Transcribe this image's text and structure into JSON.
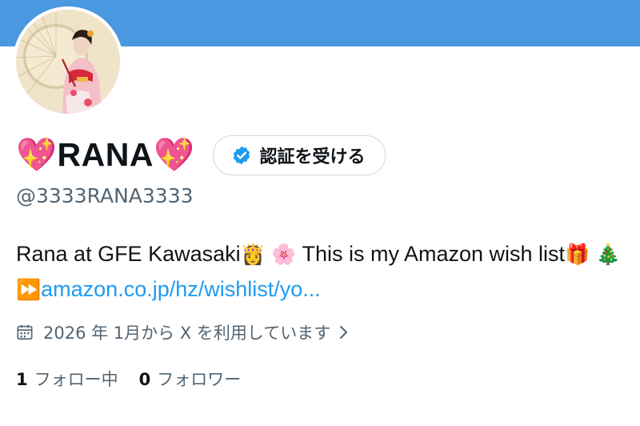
{
  "colors": {
    "banner": "#4a98e0",
    "link": "#1d9bf0",
    "secondary_text": "#536471",
    "verified_badge": "#1d9bf0"
  },
  "profile": {
    "avatar_icon": "avatar-photo",
    "display_name": "💖RANA💖",
    "handle": "@3333RANA3333",
    "verify_button": {
      "icon": "verified-badge-icon",
      "label": "認証を受ける"
    }
  },
  "bio": {
    "text_part1": "Rana at GFE Kawasaki",
    "emoji1": "👸",
    "emoji2": "🌸",
    "text_part2": " This is my Amazon wish list",
    "emoji3": "🎁",
    "emoji4": "🎄",
    "emoji5": "⏩",
    "link_text": "amazon.co.jp/hz/wishlist/yo..."
  },
  "joined": {
    "icon": "calendar-icon",
    "text": "2026 年 1月から X を利用しています",
    "chevron_icon": "chevron-right-icon"
  },
  "stats": {
    "following_count": "1",
    "following_label": "フォロー中",
    "followers_count": "0",
    "followers_label": "フォロワー"
  }
}
